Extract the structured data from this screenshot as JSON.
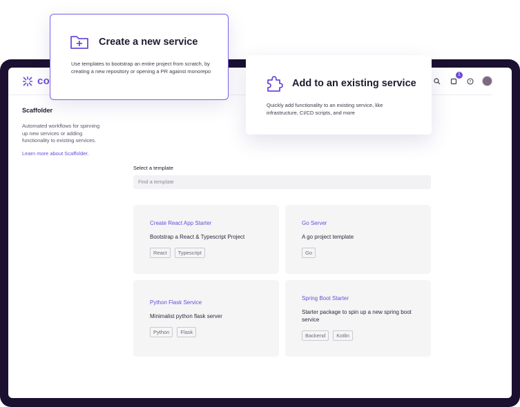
{
  "app": {
    "logo_text": "coı",
    "notification_count": "1"
  },
  "sidebar": {
    "title": "Scaffolder",
    "description": "Automated workflows for spinning up new services or adding functionality to existing services.",
    "learn_more": "Learn more about Scaffolder."
  },
  "main": {
    "select_label": "Select a template",
    "search_placeholder": "Find a template",
    "templates": [
      {
        "title": "Create React App Starter",
        "description": "Bootstrap a React & Typescript Project",
        "tags": [
          "React",
          "Typescript"
        ]
      },
      {
        "title": "Go Server",
        "description": "A go project template",
        "tags": [
          "Go"
        ]
      },
      {
        "title": "Python Flask Service",
        "description": "Minimalist python flask server",
        "tags": [
          "Python",
          "Flask"
        ]
      },
      {
        "title": "Spring Boot Starter",
        "description": "Starter package to spin up a new spring boot service",
        "tags": [
          "Backend",
          "Kotlin"
        ]
      }
    ]
  },
  "feature_cards": {
    "create": {
      "title": "Create a new service",
      "description": "Use templates to bootstrap an entire project from scratch, by creating a new repository or opening a PR against monorepo",
      "icon": "folder-plus-icon"
    },
    "add": {
      "title": "Add to an existing service",
      "description": "Quickly add functionality to an existing service, like infrastructure, CI/CD scripts, and more",
      "icon": "puzzle-icon"
    }
  },
  "colors": {
    "accent": "#6b4bd8",
    "frame": "#1b1030",
    "card_bg": "#f5f5f6"
  }
}
